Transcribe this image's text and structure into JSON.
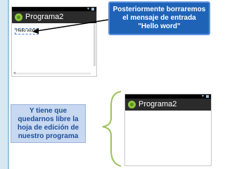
{
  "screenshot1": {
    "app_title": "Programa2",
    "hello_text": "Hello world"
  },
  "callout_top": {
    "text": "Posteriormente borraremos el mensaje de entrada \"Hello word\""
  },
  "screenshot2": {
    "app_title": "Programa2"
  },
  "callout_left": {
    "text": "Y tiene que quedarnos libre la hoja de edición de nuestro programa"
  },
  "colors": {
    "callout_top_bg": "#1f63b7",
    "callout_left_bg": "#c7d8f0",
    "arrow": "#000000",
    "brace": "#9bc25a"
  }
}
